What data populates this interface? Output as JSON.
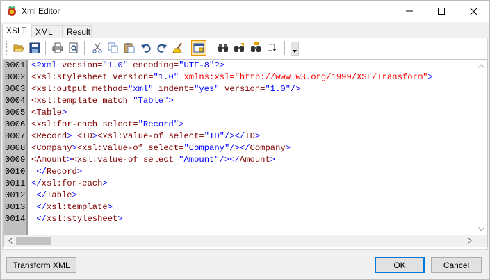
{
  "window": {
    "title": "Xml Editor",
    "icon": "app-icon"
  },
  "tabs": [
    {
      "label": "XSLT",
      "active": true
    },
    {
      "label": "XML",
      "active": false
    },
    {
      "label": "Result",
      "active": false
    }
  ],
  "toolbar": {
    "buttons": [
      "open-icon",
      "save-icon",
      "print-icon",
      "print-preview-icon",
      "cut-icon",
      "copy-icon",
      "paste-icon",
      "undo-icon",
      "redo-icon",
      "clear-icon",
      "toggle-view-icon",
      "find-icon",
      "find-next-icon",
      "replace-icon",
      "goto-icon"
    ],
    "pressed": "toggle-view-icon"
  },
  "editor": {
    "lines": [
      {
        "num": "0001",
        "segments": [
          [
            "<?xml ",
            "blue"
          ],
          [
            "version=",
            "maroon"
          ],
          [
            "\"1.0\" ",
            "blue"
          ],
          [
            "encoding=",
            "maroon"
          ],
          [
            "\"UTF-8\"",
            "blue"
          ],
          [
            "?>",
            "blue"
          ]
        ]
      },
      {
        "num": "0002",
        "segments": [
          [
            "<xsl:stylesheet ",
            "maroon"
          ],
          [
            "version=",
            "maroon"
          ],
          [
            "\"1.0\" ",
            "blue"
          ],
          [
            "xmlns:xsl=",
            "red"
          ],
          [
            "\"http://www.w3.org/1999/XSL/Transform\"",
            "red"
          ],
          [
            ">",
            "blue"
          ]
        ]
      },
      {
        "num": "0003",
        "segments": [
          [
            "<xsl:output ",
            "maroon"
          ],
          [
            "method=",
            "maroon"
          ],
          [
            "\"xml\" ",
            "blue"
          ],
          [
            "indent=",
            "maroon"
          ],
          [
            "\"yes\" ",
            "blue"
          ],
          [
            "version=",
            "maroon"
          ],
          [
            "\"1.0\"",
            "blue"
          ],
          [
            "/>",
            "blue"
          ]
        ]
      },
      {
        "num": "0004",
        "segments": [
          [
            "<xsl:template ",
            "maroon"
          ],
          [
            "match=",
            "maroon"
          ],
          [
            "\"Table\"",
            "blue"
          ],
          [
            ">",
            "blue"
          ]
        ]
      },
      {
        "num": "0005",
        "segments": [
          [
            "<Table",
            "maroon"
          ],
          [
            ">",
            "blue"
          ]
        ]
      },
      {
        "num": "0006",
        "segments": [
          [
            "<xsl:for-each ",
            "maroon"
          ],
          [
            "select=",
            "maroon"
          ],
          [
            "\"Record\"",
            "blue"
          ],
          [
            ">",
            "blue"
          ]
        ]
      },
      {
        "num": "0007",
        "segments": [
          [
            "<Record",
            "maroon"
          ],
          [
            "> ",
            "blue"
          ],
          [
            "<ID",
            "maroon"
          ],
          [
            ">",
            "blue"
          ],
          [
            "<xsl:value-of ",
            "maroon"
          ],
          [
            "select=",
            "maroon"
          ],
          [
            "\"ID\"",
            "blue"
          ],
          [
            "/></",
            "blue"
          ],
          [
            "ID",
            "maroon"
          ],
          [
            ">",
            "blue"
          ]
        ]
      },
      {
        "num": "0008",
        "segments": [
          [
            "<Company",
            "maroon"
          ],
          [
            ">",
            "blue"
          ],
          [
            "<xsl:value-of ",
            "maroon"
          ],
          [
            "select=",
            "maroon"
          ],
          [
            "\"Company\"",
            "blue"
          ],
          [
            "/></",
            "blue"
          ],
          [
            "Company",
            "maroon"
          ],
          [
            ">",
            "blue"
          ]
        ]
      },
      {
        "num": "0009",
        "segments": [
          [
            "<Amount",
            "maroon"
          ],
          [
            ">",
            "blue"
          ],
          [
            "<xsl:value-of ",
            "maroon"
          ],
          [
            "select=",
            "maroon"
          ],
          [
            "\"Amount\"",
            "blue"
          ],
          [
            "/></",
            "blue"
          ],
          [
            "Amount",
            "maroon"
          ],
          [
            ">",
            "blue"
          ]
        ]
      },
      {
        "num": "0010",
        "segments": [
          [
            " </",
            "blue"
          ],
          [
            "Record",
            "maroon"
          ],
          [
            ">",
            "blue"
          ]
        ]
      },
      {
        "num": "0011",
        "segments": [
          [
            "</",
            "blue"
          ],
          [
            "xsl:for-each",
            "maroon"
          ],
          [
            ">",
            "blue"
          ]
        ]
      },
      {
        "num": "0012",
        "segments": [
          [
            " </",
            "blue"
          ],
          [
            "Table",
            "maroon"
          ],
          [
            ">",
            "blue"
          ]
        ]
      },
      {
        "num": "0013",
        "segments": [
          [
            " </",
            "blue"
          ],
          [
            "xsl:template",
            "maroon"
          ],
          [
            ">",
            "blue"
          ]
        ]
      },
      {
        "num": "0014",
        "segments": [
          [
            " </",
            "blue"
          ],
          [
            "xsl:stylesheet",
            "maroon"
          ],
          [
            ">",
            "blue"
          ]
        ]
      }
    ]
  },
  "buttons": {
    "transform": "Transform XML",
    "ok": "OK",
    "cancel": "Cancel"
  },
  "colors": {
    "blue": "#0000ff",
    "maroon": "#800000",
    "red": "#ff0000",
    "accent": "#0078d7"
  }
}
